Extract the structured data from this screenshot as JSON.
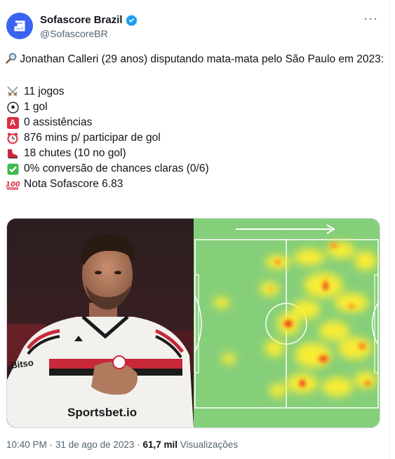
{
  "account": {
    "name": "Sofascore Brazil",
    "handle": "@SofascoreBR",
    "verified_color": "#1d9bf0",
    "brand_color": "#3a63f3"
  },
  "tweet": {
    "intro_icon": "magnifier-icon",
    "intro": "Jonathan Calleri (29 anos) disputando mata-mata pelo São Paulo em 2023:",
    "stats": [
      {
        "icon": "crossed-swords-icon",
        "glyph": "⚔",
        "text": "11 jogos"
      },
      {
        "icon": "soccer-ball-icon",
        "glyph": "⚽",
        "text": "1 gol"
      },
      {
        "icon": "letter-a-icon",
        "glyph": "A",
        "text": "0 assistências"
      },
      {
        "icon": "alarm-clock-icon",
        "glyph": "⏰",
        "text": "876 mins p/ participar de gol"
      },
      {
        "icon": "boot-icon",
        "glyph": "👟",
        "text": "18 chutes (10 no gol)"
      },
      {
        "icon": "check-mark-icon",
        "glyph": "✔",
        "text": "0% conversão de chances claras (0/6)"
      },
      {
        "icon": "hundred-points-icon",
        "glyph": "100",
        "text": "Nota Sofascore 6.83"
      }
    ]
  },
  "footer": {
    "time": "10:40 PM",
    "sep": "·",
    "date": "31 de ago de 2023",
    "views_count": "61,7 mil",
    "views_label": "Visualizações"
  },
  "photo_shirt_text": {
    "left": "Bitso",
    "sponsor": "Sportsbet.io"
  }
}
